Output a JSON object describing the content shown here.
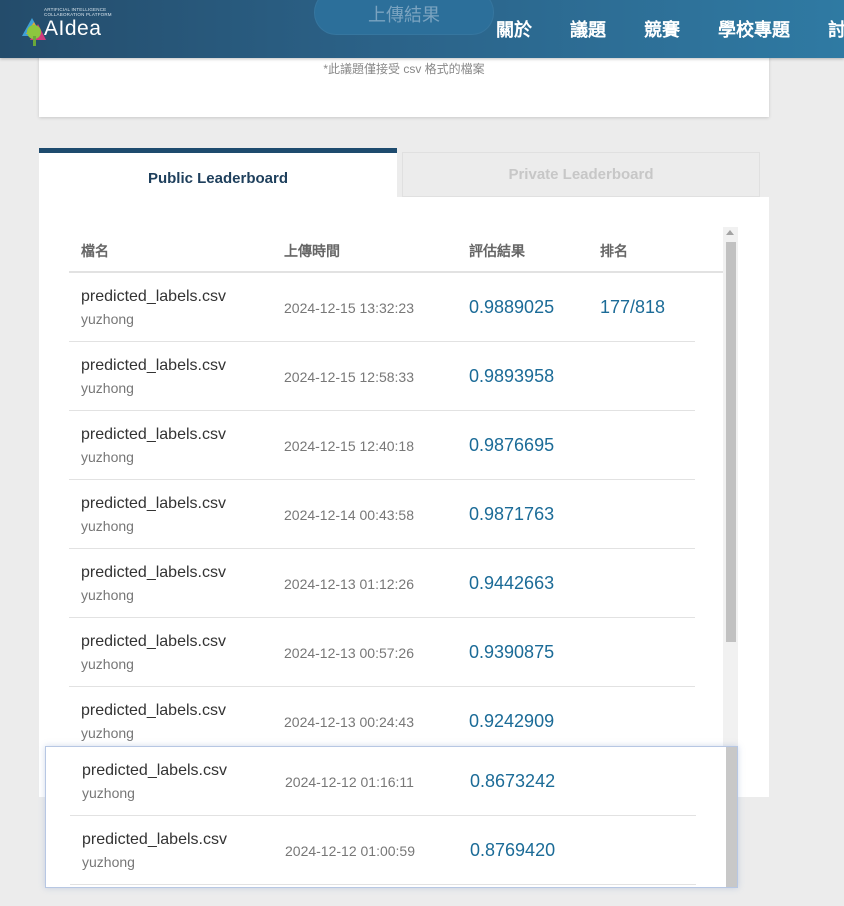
{
  "header": {
    "logo_tagline": "ARTIFICIAL INTELLIGENCE COLLABORATION PLATFORM",
    "logo_text": "AIdea",
    "upload_button": "上傳結果",
    "nav": [
      "關於",
      "議題",
      "競賽",
      "學校專題",
      "討"
    ]
  },
  "top_card": {
    "note": "*此議題僅接受 csv 格式的檔案"
  },
  "tabs": {
    "public": "Public Leaderboard",
    "private": "Private Leaderboard"
  },
  "table": {
    "headers": {
      "filename": "檔名",
      "upload_time": "上傳時間",
      "result": "評估結果",
      "rank": "排名"
    },
    "rows": [
      {
        "filename": "predicted_labels.csv",
        "user": "yuzhong",
        "time": "2024-12-15 13:32:23",
        "score": "0.9889025",
        "rank": "177/818"
      },
      {
        "filename": "predicted_labels.csv",
        "user": "yuzhong",
        "time": "2024-12-15 12:58:33",
        "score": "0.9893958",
        "rank": ""
      },
      {
        "filename": "predicted_labels.csv",
        "user": "yuzhong",
        "time": "2024-12-15 12:40:18",
        "score": "0.9876695",
        "rank": ""
      },
      {
        "filename": "predicted_labels.csv",
        "user": "yuzhong",
        "time": "2024-12-14 00:43:58",
        "score": "0.9871763",
        "rank": ""
      },
      {
        "filename": "predicted_labels.csv",
        "user": "yuzhong",
        "time": "2024-12-13 01:12:26",
        "score": "0.9442663",
        "rank": ""
      },
      {
        "filename": "predicted_labels.csv",
        "user": "yuzhong",
        "time": "2024-12-13 00:57:26",
        "score": "0.9390875",
        "rank": ""
      },
      {
        "filename": "predicted_labels.csv",
        "user": "yuzhong",
        "time": "2024-12-13 00:24:43",
        "score": "0.9242909",
        "rank": ""
      }
    ],
    "overlay_rows": [
      {
        "filename": "predicted_labels.csv",
        "user": "yuzhong",
        "time": "2024-12-12 01:16:11",
        "score": "0.8673242",
        "rank": ""
      },
      {
        "filename": "predicted_labels.csv",
        "user": "yuzhong",
        "time": "2024-12-12 01:00:59",
        "score": "0.8769420",
        "rank": ""
      }
    ]
  },
  "colors": {
    "header_start": "#244c6b",
    "header_end": "#2f7aa3",
    "accent_score": "#1b6b97",
    "tab_active_border": "#1e4b6e"
  },
  "icons": {
    "logo": "aidea-tree-logo-icon",
    "scroll_up": "scroll-up-arrow-icon"
  }
}
